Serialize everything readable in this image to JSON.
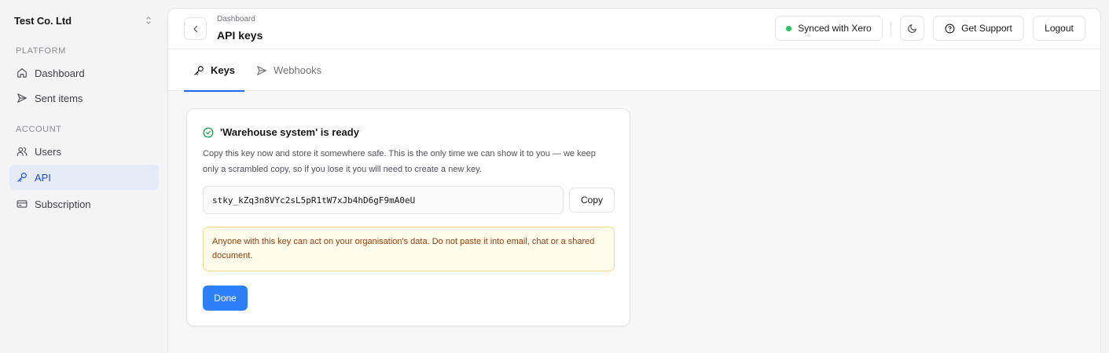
{
  "sidebar": {
    "org_name": "Test Co. Ltd",
    "sections": [
      {
        "label": "PLATFORM",
        "items": [
          {
            "label": "Dashboard",
            "icon": "home-icon"
          },
          {
            "label": "Sent items",
            "icon": "send-icon"
          }
        ]
      },
      {
        "label": "ACCOUNT",
        "items": [
          {
            "label": "Users",
            "icon": "users-icon"
          },
          {
            "label": "API",
            "icon": "key-icon",
            "active": true
          },
          {
            "label": "Subscription",
            "icon": "credit-card-icon"
          }
        ]
      }
    ]
  },
  "header": {
    "breadcrumb": "Dashboard",
    "title": "API keys",
    "sync_label": "Synced with Xero",
    "sync_color": "#22c55e",
    "support_label": "Get Support",
    "logout_label": "Logout"
  },
  "tabs": [
    {
      "label": "Keys",
      "icon": "key-icon",
      "active": true
    },
    {
      "label": "Webhooks",
      "icon": "send-icon",
      "active": false
    }
  ],
  "card": {
    "title": "'Warehouse system' is ready",
    "description": "Copy this key now and store it somewhere safe. This is the only time we can show it to you — we keep only a scrambled copy, so if you lose it you will need to create a new key.",
    "api_key": "stky_kZq3n8VYc2sL5pR1tW7xJb4hD6gF9mA0eU",
    "copy_label": "Copy",
    "warning": "Anyone with this key can act on your organisation's data. Do not paste it into email, chat or a shared document.",
    "done_label": "Done"
  },
  "colors": {
    "accent": "#2563eb",
    "primary_button": "#2d7ff9",
    "success": "#16a34a",
    "warning_bg": "#fffbeb",
    "warning_text": "#92400e"
  }
}
